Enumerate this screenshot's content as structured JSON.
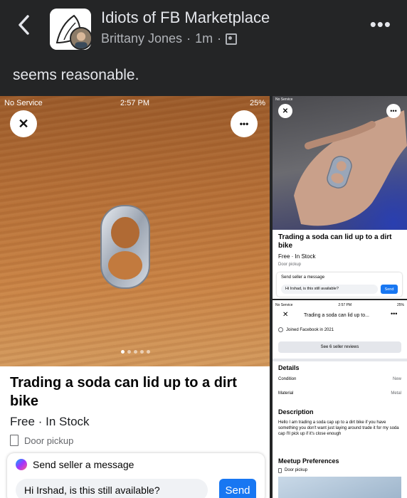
{
  "post": {
    "group_name": "Idiots of FB Marketplace",
    "author": "Brittany Jones",
    "time": "1m",
    "separator": "·",
    "caption": "seems reasonable."
  },
  "main_screenshot": {
    "status_left": "No Service",
    "status_time": "2:57 PM",
    "status_right": "25%",
    "close_glyph": "✕",
    "more_glyph": "•••",
    "title": "Trading a soda can lid up to a dirt bike",
    "price": "Free",
    "stock": "In Stock",
    "pickup": "Door pickup",
    "message_heading": "Send seller a message",
    "message_value": "Hi Irshad, is this still available?",
    "send_label": "Send"
  },
  "top_right_screenshot": {
    "status_left": "No Service",
    "close_glyph": "✕",
    "more_glyph": "•••",
    "title": "Trading a soda can lid up to a dirt bike",
    "sub": "Free · In Stock",
    "pickup": "Door pickup",
    "message_heading": "Send seller a message",
    "message_value": "Hi Irshad, is this still available?",
    "send_label": "Send"
  },
  "bottom_right_screenshot": {
    "status_left": "No Service",
    "status_time": "2:57 PM",
    "status_right": "25%",
    "nav_title": "Trading a soda can lid up to...",
    "joined": "Joined Facebook in 2021",
    "reviews_button": "See 6 seller reviews",
    "details_heading": "Details",
    "condition_label": "Condition",
    "condition_value": "New",
    "material_label": "Material",
    "material_value": "Metal",
    "description_heading": "Description",
    "description": "Hello I am trading a soda cap up to a dirt bike if you have something you don't want just laying around trade it for my soda cap I'll pick up if it's close enough",
    "meetup_heading": "Meetup Preferences",
    "meetup_value": "Door pickup"
  },
  "icons": {
    "back": "chevron-left-icon",
    "privacy": "friends-icon",
    "messenger": "messenger-icon",
    "door": "door-icon",
    "globe": "globe-icon"
  },
  "colors": {
    "dark_bg": "#242526",
    "send_blue": "#1877f2",
    "wood": "#b46e36"
  }
}
